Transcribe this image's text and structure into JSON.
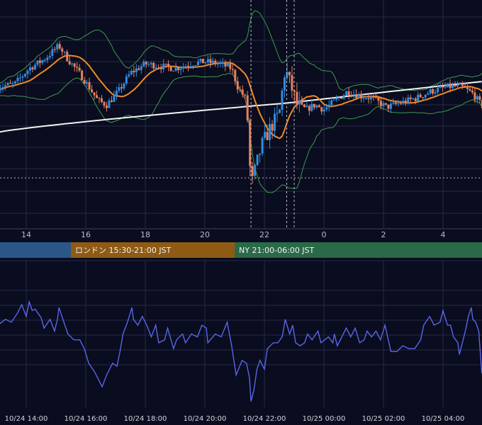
{
  "colors": {
    "background": "#0a0c1f",
    "grid": "#252a44",
    "candle_up": "#2f8de0",
    "candle_down": "#e8805e",
    "ma_short": "#f08a24",
    "ma_long": "#f2f2f2",
    "bollinger": "#3f9a50",
    "oscillator": "#5966e8",
    "session_tokyo": "#2a5788",
    "session_london": "#8e5a14",
    "session_ny": "#2a6a48"
  },
  "chart_data": [
    {
      "type": "candlestick",
      "x_axis": {
        "ticks": [
          "14",
          "16",
          "18",
          "20",
          "22",
          "0",
          "2",
          "4"
        ],
        "range_hours": [
          13.05,
          29.4
        ]
      },
      "y_range": [
        0,
        100
      ],
      "markers": {
        "vertical_lines_hours": [
          21.55,
          22.75,
          23.0
        ],
        "horizontal_line_level": 22
      },
      "indicators": [
        "ma_short",
        "ma_long",
        "bollinger_bands"
      ]
    },
    {
      "type": "line",
      "name": "oscillator",
      "y_range": [
        0,
        100
      ],
      "x_range_hours": [
        13.05,
        29.4
      ],
      "points": [
        [
          13.05,
          56
        ],
        [
          13.3,
          60
        ],
        [
          13.5,
          58
        ],
        [
          13.7,
          64
        ],
        [
          13.85,
          70
        ],
        [
          14.0,
          62
        ],
        [
          14.1,
          72
        ],
        [
          14.2,
          66
        ],
        [
          14.3,
          67
        ],
        [
          14.5,
          61
        ],
        [
          14.6,
          54
        ],
        [
          14.8,
          60
        ],
        [
          14.95,
          52
        ],
        [
          15.05,
          60
        ],
        [
          15.1,
          68
        ],
        [
          15.3,
          56
        ],
        [
          15.4,
          50
        ],
        [
          15.6,
          46
        ],
        [
          15.8,
          46
        ],
        [
          15.95,
          40
        ],
        [
          16.1,
          30
        ],
        [
          16.3,
          24
        ],
        [
          16.45,
          18
        ],
        [
          16.55,
          14
        ],
        [
          16.7,
          22
        ],
        [
          16.9,
          30
        ],
        [
          17.05,
          28
        ],
        [
          17.15,
          38
        ],
        [
          17.25,
          50
        ],
        [
          17.4,
          58
        ],
        [
          17.55,
          68
        ],
        [
          17.6,
          60
        ],
        [
          17.75,
          56
        ],
        [
          17.9,
          62
        ],
        [
          18.05,
          56
        ],
        [
          18.2,
          48
        ],
        [
          18.35,
          56
        ],
        [
          18.45,
          44
        ],
        [
          18.65,
          46
        ],
        [
          18.75,
          54
        ],
        [
          18.95,
          40
        ],
        [
          19.05,
          46
        ],
        [
          19.25,
          50
        ],
        [
          19.35,
          44
        ],
        [
          19.55,
          50
        ],
        [
          19.75,
          48
        ],
        [
          19.9,
          56
        ],
        [
          20.05,
          54
        ],
        [
          20.1,
          44
        ],
        [
          20.35,
          50
        ],
        [
          20.55,
          48
        ],
        [
          20.75,
          58
        ],
        [
          20.9,
          42
        ],
        [
          21.05,
          22
        ],
        [
          21.25,
          32
        ],
        [
          21.4,
          30
        ],
        [
          21.5,
          20
        ],
        [
          21.55,
          4
        ],
        [
          21.65,
          12
        ],
        [
          21.75,
          26
        ],
        [
          21.85,
          32
        ],
        [
          22.0,
          26
        ],
        [
          22.1,
          40
        ],
        [
          22.3,
          44
        ],
        [
          22.45,
          44
        ],
        [
          22.6,
          48
        ],
        [
          22.7,
          60
        ],
        [
          22.85,
          50
        ],
        [
          22.95,
          56
        ],
        [
          23.05,
          44
        ],
        [
          23.2,
          42
        ],
        [
          23.35,
          44
        ],
        [
          23.45,
          50
        ],
        [
          23.6,
          46
        ],
        [
          23.8,
          52
        ],
        [
          23.9,
          44
        ],
        [
          24.15,
          48
        ],
        [
          24.3,
          44
        ],
        [
          24.35,
          50
        ],
        [
          24.45,
          42
        ],
        [
          24.65,
          50
        ],
        [
          24.75,
          54
        ],
        [
          24.9,
          48
        ],
        [
          25.05,
          54
        ],
        [
          25.2,
          44
        ],
        [
          25.35,
          46
        ],
        [
          25.45,
          52
        ],
        [
          25.6,
          48
        ],
        [
          25.75,
          52
        ],
        [
          25.9,
          46
        ],
        [
          26.05,
          56
        ],
        [
          26.25,
          38
        ],
        [
          26.45,
          38
        ],
        [
          26.65,
          42
        ],
        [
          26.85,
          40
        ],
        [
          27.05,
          40
        ],
        [
          27.25,
          46
        ],
        [
          27.35,
          56
        ],
        [
          27.55,
          62
        ],
        [
          27.7,
          56
        ],
        [
          27.9,
          58
        ],
        [
          28.0,
          66
        ],
        [
          28.15,
          56
        ],
        [
          28.25,
          56
        ],
        [
          28.35,
          48
        ],
        [
          28.5,
          44
        ],
        [
          28.55,
          36
        ],
        [
          28.75,
          52
        ],
        [
          28.85,
          62
        ],
        [
          28.95,
          68
        ],
        [
          29.0,
          60
        ],
        [
          29.1,
          58
        ],
        [
          29.2,
          52
        ],
        [
          29.3,
          24
        ],
        [
          29.4,
          18
        ]
      ],
      "x_axis": {
        "ticks": [
          "10/24 14:00",
          "10/24 16:00",
          "10/24 18:00",
          "10/24 20:00",
          "10/24 22:00",
          "10/25 00:00",
          "10/25 02:00",
          "10/25 04:00"
        ]
      }
    }
  ],
  "session_bar": [
    {
      "label": "",
      "start_hour": 13.05,
      "end_hour": 15.5,
      "color_key": "session_tokyo"
    },
    {
      "label": "ロンドン 15:30-21:00 JST",
      "start_hour": 15.5,
      "end_hour": 21.0,
      "color_key": "session_london"
    },
    {
      "label": "NY 21:00-06:00 JST",
      "start_hour": 21.0,
      "end_hour": 29.4,
      "color_key": "session_ny"
    }
  ]
}
